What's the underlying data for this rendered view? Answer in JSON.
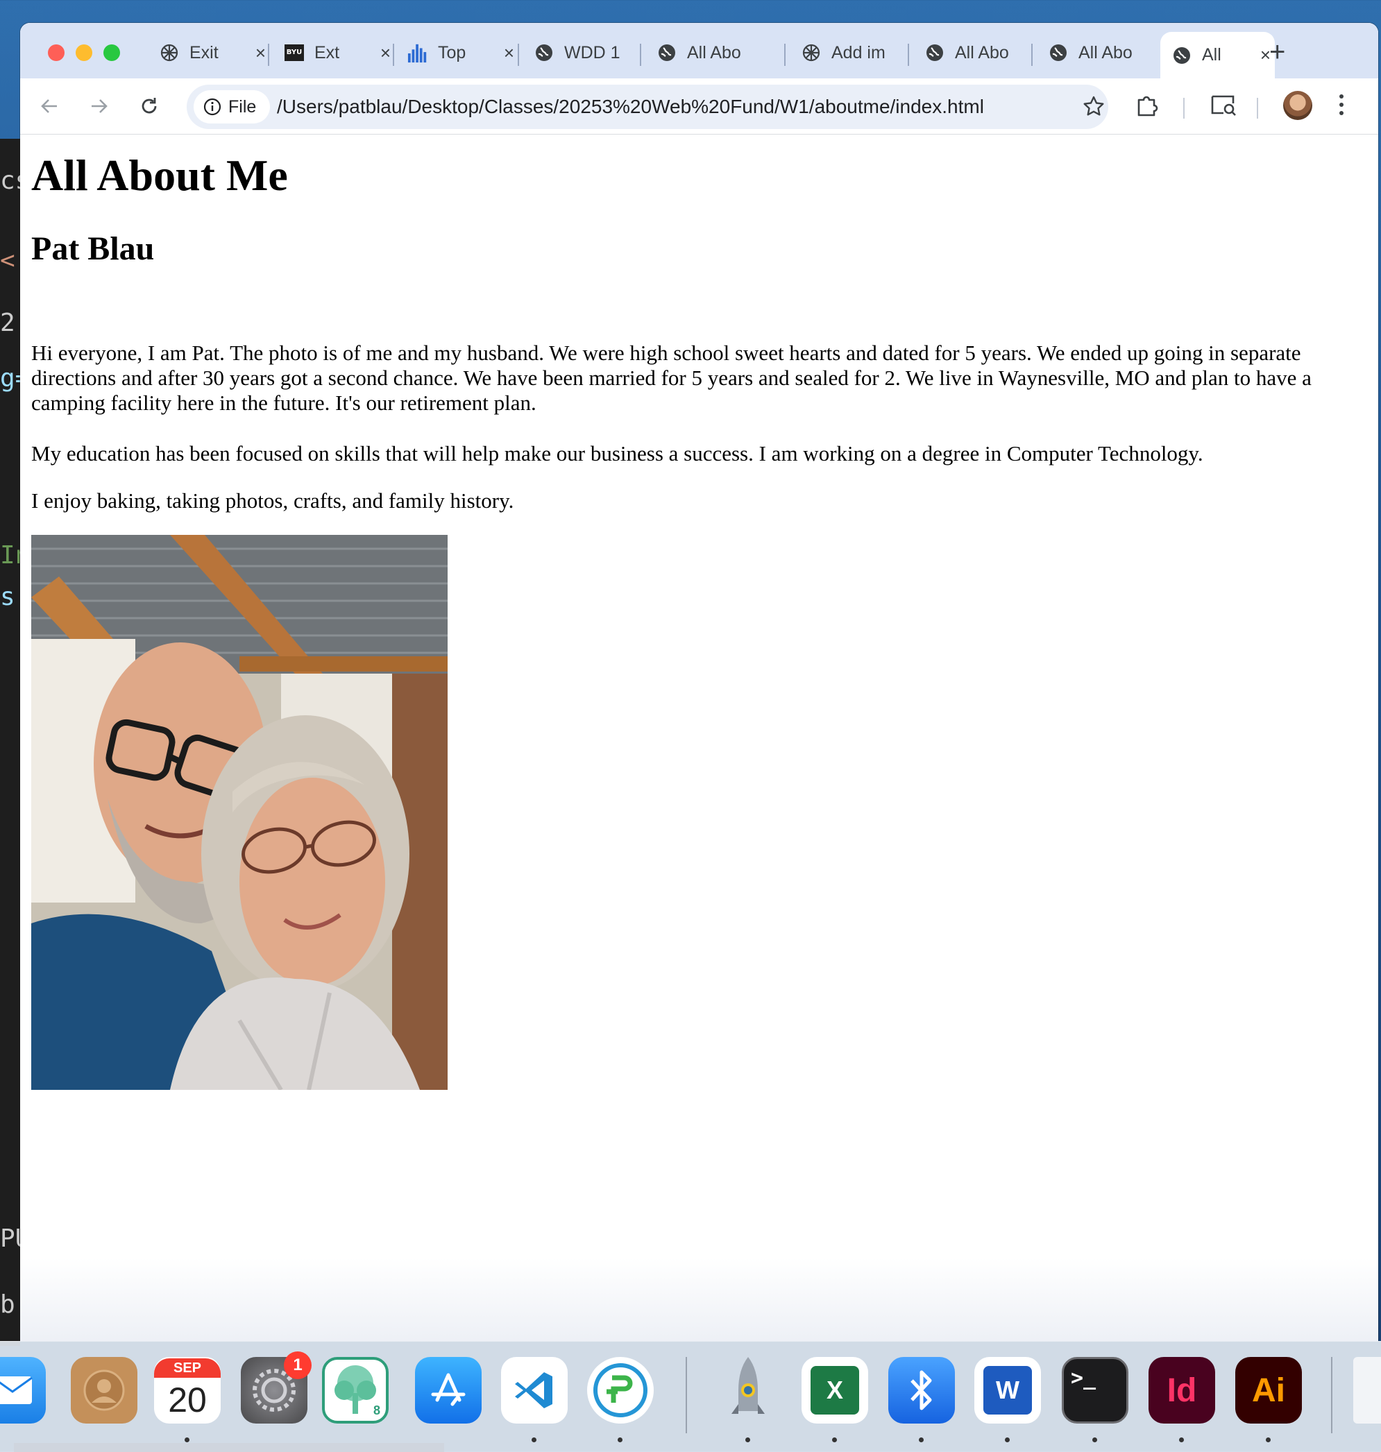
{
  "background_editor": {
    "fragments": [
      "cs",
      "<",
      "2",
      "g=",
      "In",
      "s",
      "PU",
      "b"
    ]
  },
  "browser": {
    "tabs": [
      {
        "label": "Exit",
        "icon": "openai-icon",
        "closable": true
      },
      {
        "label": "Ext",
        "icon": "byu-idaho-icon",
        "closable": true
      },
      {
        "label": "Top",
        "icon": "bar-chart-icon",
        "closable": true
      },
      {
        "label": "WDD 1",
        "icon": "globe-icon",
        "closable": false
      },
      {
        "label": "All Abo",
        "icon": "globe-icon",
        "closable": false
      },
      {
        "label": "Add im",
        "icon": "openai-icon",
        "closable": false
      },
      {
        "label": "All Abo",
        "icon": "globe-icon",
        "closable": false
      },
      {
        "label": "All Abo",
        "icon": "globe-icon",
        "closable": false
      },
      {
        "label": "All",
        "icon": "globe-icon",
        "closable": true,
        "active": true
      }
    ],
    "address": {
      "chip_label": "File",
      "url": "/Users/patblau/Desktop/Classes/20253%20Web%20Fund/W1/aboutme/index.html"
    }
  },
  "page": {
    "heading": "All About Me",
    "subheading": "Pat Blau",
    "paragraphs": [
      "Hi everyone, I am Pat. The photo is of me and my husband. We were high school sweet hearts and dated for 5 years. We ended up going in separate directions and after 30 years got a second chance. We have been married for 5 years and sealed for 2. We live in Waynesville, MO and plan to have a camping facility here in the future. It's our retirement plan.",
      "My education has been focused on skills that will help make our business a success. I am working on a degree in Computer Technology.",
      "I enjoy baking, taking photos, crafts, and family history."
    ]
  },
  "dock": {
    "calendar": {
      "month": "SEP",
      "day": "20"
    },
    "settings_badge": "1",
    "tree_badge": "8",
    "excel_letter": "X",
    "word_letter": "W",
    "indesign_label": "Id",
    "illustrator_label": "Ai",
    "terminal_prompt": ">_"
  },
  "colors": {
    "tabstrip": "#d9e3f5",
    "omnibox": "#eaeff8",
    "close_red": "#fe5f57",
    "minimize_yellow": "#febc2e",
    "zoom_green": "#28c840"
  }
}
